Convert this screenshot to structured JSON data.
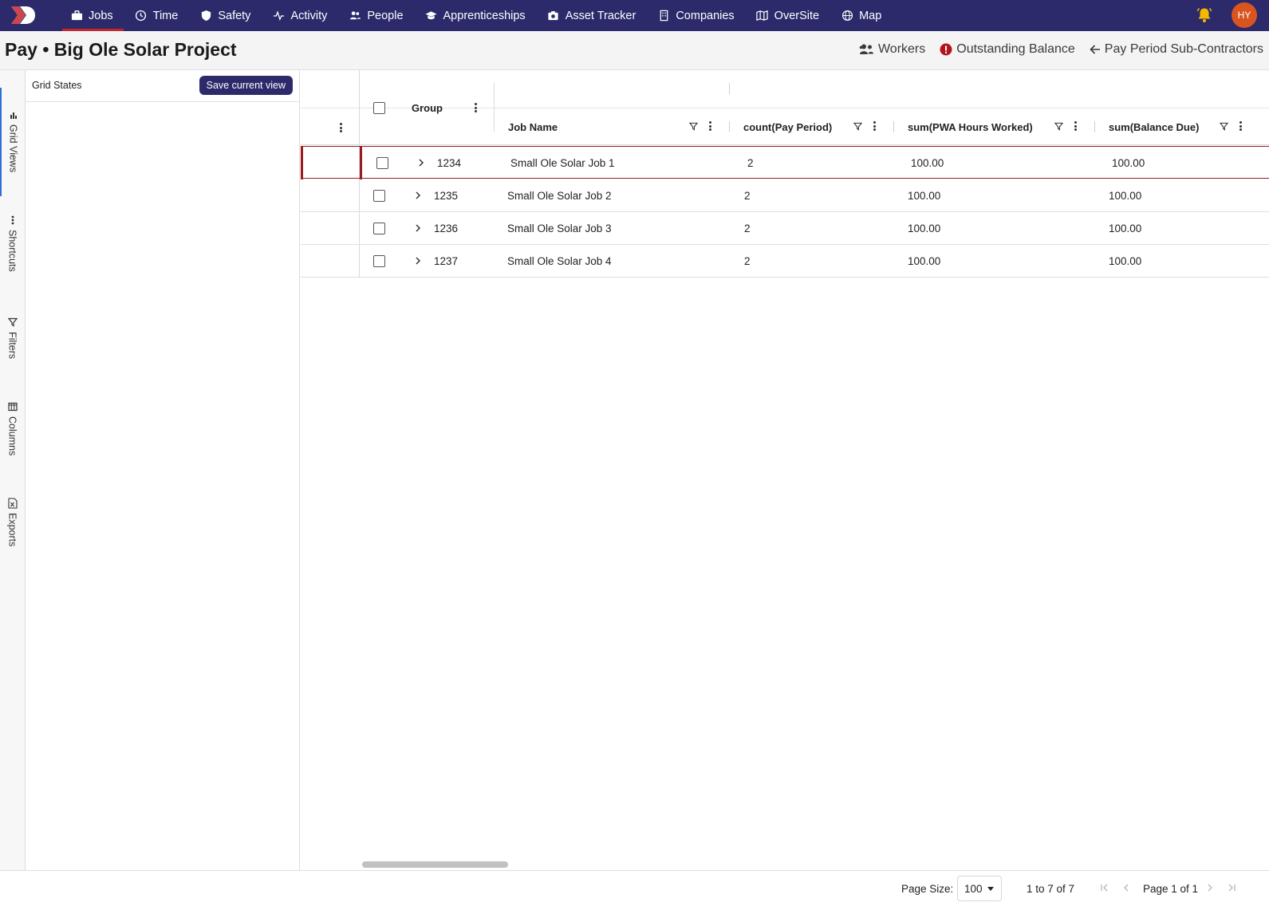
{
  "nav": {
    "items": [
      {
        "label": "Jobs",
        "icon": "briefcase-icon",
        "active": true
      },
      {
        "label": "Time",
        "icon": "clock-icon"
      },
      {
        "label": "Safety",
        "icon": "shield-icon"
      },
      {
        "label": "Activity",
        "icon": "pulse-icon"
      },
      {
        "label": "People",
        "icon": "people-icon"
      },
      {
        "label": "Apprenticeships",
        "icon": "graduation-cap-icon"
      },
      {
        "label": "Asset Tracker",
        "icon": "camera-icon"
      },
      {
        "label": "Companies",
        "icon": "building-icon"
      },
      {
        "label": "OverSite",
        "icon": "map-fold-icon"
      },
      {
        "label": "Map",
        "icon": "globe-icon"
      }
    ],
    "avatar_initials": "HY",
    "colors": {
      "bar": "#2c2a6b",
      "active_underline": "#c4262e",
      "bell": "#f5b800",
      "avatar": "#d9541e"
    }
  },
  "header": {
    "title": "Pay • Big Ole Solar Project",
    "actions": {
      "workers": "Workers",
      "outstanding": "Outstanding Balance",
      "back": "Pay Period Sub-Contractors"
    }
  },
  "side_tabs": [
    {
      "label": "Grid Views",
      "icon": "bar-chart-icon",
      "active": true
    },
    {
      "label": "Shortcuts",
      "icon": "dots-vertical-icon"
    },
    {
      "label": "Filters",
      "icon": "filter-icon"
    },
    {
      "label": "Columns",
      "icon": "columns-icon"
    },
    {
      "label": "Exports",
      "icon": "excel-file-icon"
    }
  ],
  "states_panel": {
    "title": "Grid States",
    "save_label": "Save current view"
  },
  "grid": {
    "group_header": "Group",
    "columns": [
      "Job Name",
      "count(Pay Period)",
      "sum(PWA Hours Worked)",
      "sum(Balance Due)"
    ],
    "rows": [
      {
        "group": "1234",
        "job_name": "Small Ole Solar Job 1",
        "count": "2",
        "hours": "100.00",
        "balance": "100.00",
        "selected": true
      },
      {
        "group": "1235",
        "job_name": "Small Ole Solar Job 2",
        "count": "2",
        "hours": "100.00",
        "balance": "100.00"
      },
      {
        "group": "1236",
        "job_name": "Small Ole Solar Job 3",
        "count": "2",
        "hours": "100.00",
        "balance": "100.00"
      },
      {
        "group": "1237",
        "job_name": "Small Ole Solar Job 4",
        "count": "2",
        "hours": "100.00",
        "balance": "100.00"
      }
    ]
  },
  "footer": {
    "page_size_label": "Page Size:",
    "page_size": "100",
    "range": "1 to 7 of 7",
    "page_text": "Page 1 of 1"
  }
}
